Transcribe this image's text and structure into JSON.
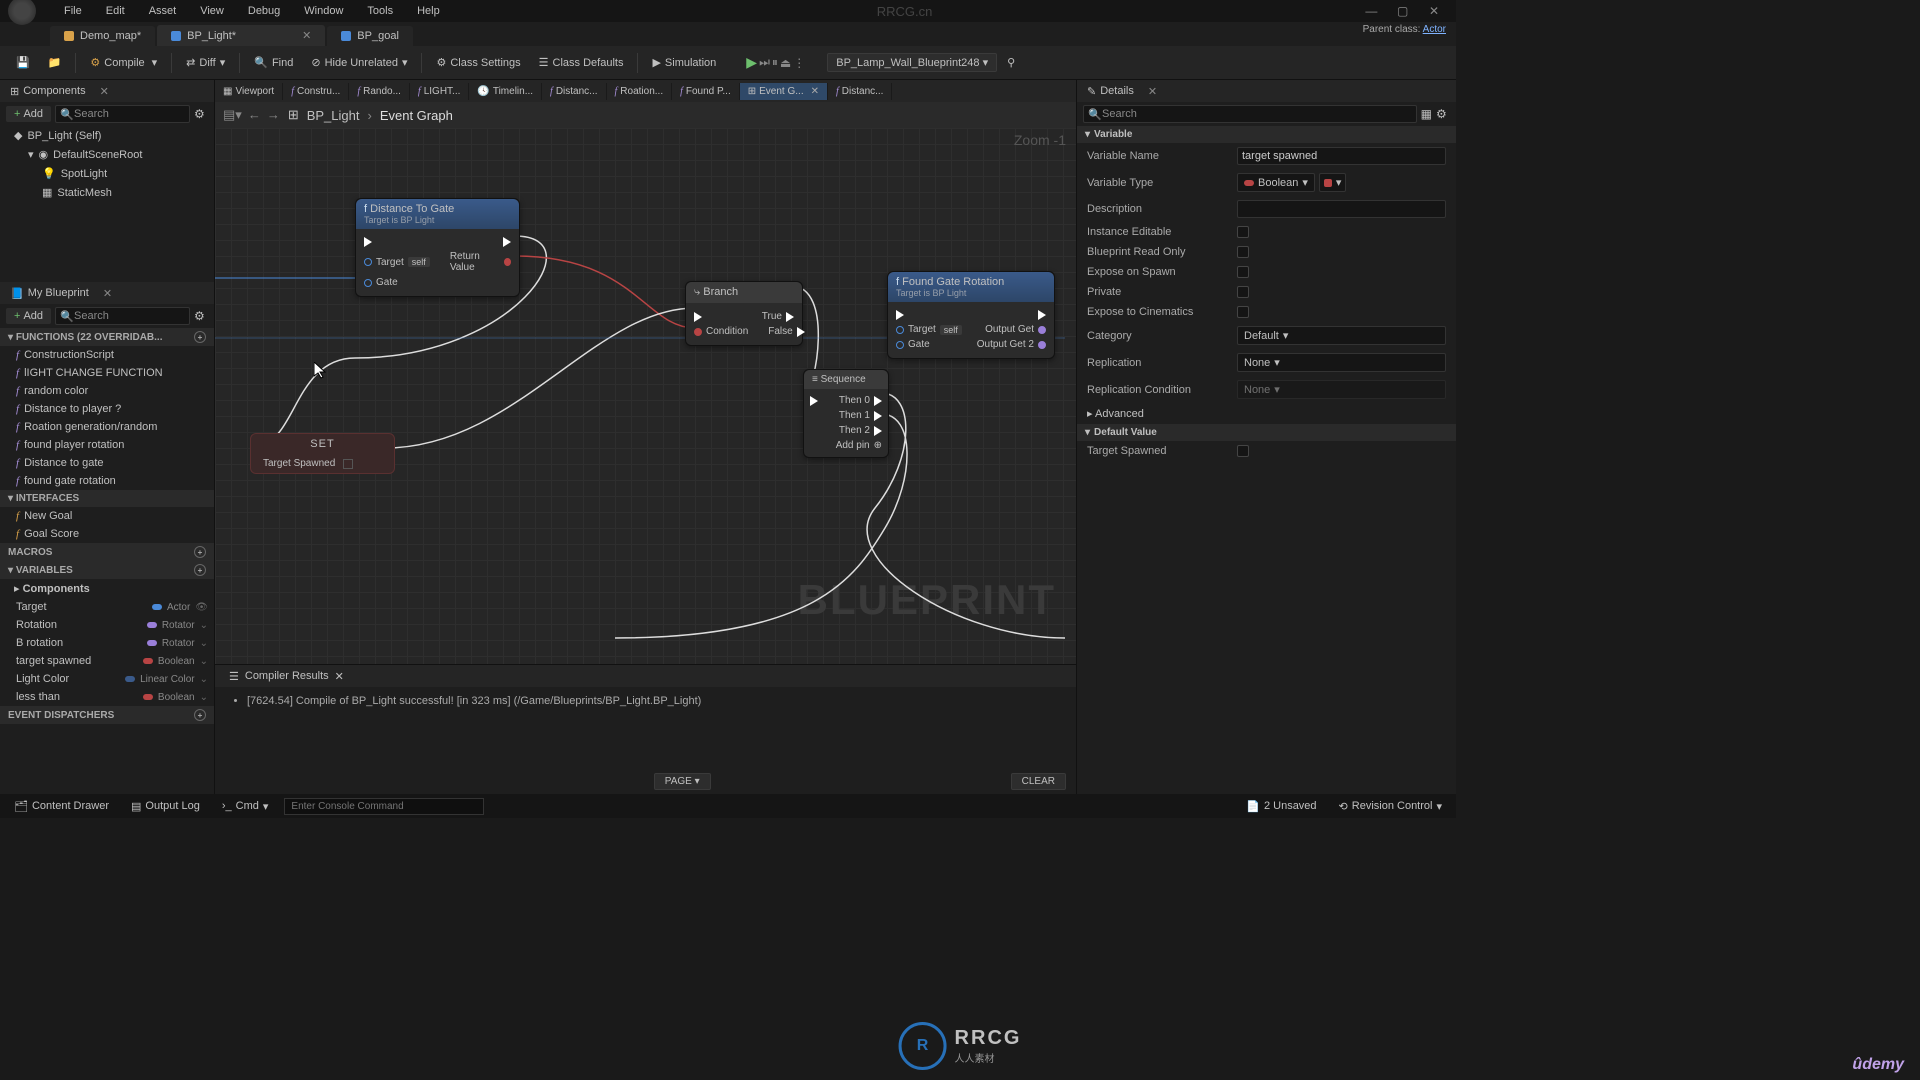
{
  "menu": {
    "items": [
      "File",
      "Edit",
      "Asset",
      "View",
      "Debug",
      "Window",
      "Tools",
      "Help"
    ],
    "center": "RRCG.cn"
  },
  "tabs": [
    {
      "label": "Demo_map*",
      "color": "#d9a24a"
    },
    {
      "label": "BP_Light*",
      "color": "#4a8ad9",
      "active": true
    },
    {
      "label": "BP_goal",
      "color": "#4a8ad9"
    }
  ],
  "parent_class": {
    "prefix": "Parent class:",
    "name": "Actor"
  },
  "toolbar": {
    "compile": "Compile",
    "diff": "Diff",
    "find": "Find",
    "hide": "Hide Unrelated",
    "class_settings": "Class Settings",
    "class_defaults": "Class Defaults",
    "simulation": "Simulation",
    "dropdown": "BP_Lamp_Wall_Blueprint248"
  },
  "components_panel": {
    "title": "Components",
    "add": "Add",
    "search_ph": "Search",
    "items": [
      {
        "label": "BP_Light (Self)",
        "indent": 0
      },
      {
        "label": "DefaultSceneRoot",
        "indent": 1
      },
      {
        "label": "SpotLight",
        "indent": 2
      },
      {
        "label": "StaticMesh",
        "indent": 2
      }
    ]
  },
  "myblueprint": {
    "title": "My Blueprint",
    "add": "Add",
    "search_ph": "Search",
    "functions_head": "FUNCTIONS (22 OVERRIDAB...",
    "functions": [
      "ConstructionScript",
      "lIGHT CHANGE FUNCTION",
      "random color",
      "Distance to player ?",
      "Roation generation/random",
      "found player rotation",
      "Distance to gate",
      "found gate rotation"
    ],
    "interfaces_head": "INTERFACES",
    "interfaces": [
      "New Goal",
      "Goal Score"
    ],
    "macros_head": "MACROS",
    "variables_head": "VARIABLES",
    "components_sub": "Components",
    "variables": [
      {
        "name": "Target",
        "type": "Actor",
        "color": "#4a8ad9"
      },
      {
        "name": "Rotation",
        "type": "Rotator",
        "color": "#9a7fd9"
      },
      {
        "name": "B rotation",
        "type": "Rotator",
        "color": "#9a7fd9"
      },
      {
        "name": "target spawned",
        "type": "Boolean",
        "color": "#b84444"
      },
      {
        "name": "Light Color",
        "type": "Linear Color",
        "color": "#3a5a8a"
      },
      {
        "name": "less than",
        "type": "Boolean",
        "color": "#b84444"
      }
    ],
    "dispatchers_head": "EVENT DISPATCHERS"
  },
  "editor_tabs": [
    {
      "label": "Viewport",
      "icon": "grid"
    },
    {
      "label": "Constru...",
      "icon": "f"
    },
    {
      "label": "Rando...",
      "icon": "f"
    },
    {
      "label": "LIGHT...",
      "icon": "f"
    },
    {
      "label": "Timelin...",
      "icon": "clock"
    },
    {
      "label": "Distanc...",
      "icon": "f"
    },
    {
      "label": "Roation...",
      "icon": "f"
    },
    {
      "label": "Found P...",
      "icon": "f"
    },
    {
      "label": "Event G...",
      "icon": "graph",
      "active": true
    },
    {
      "label": "Distanc...",
      "icon": "f"
    }
  ],
  "breadcrumb": {
    "a": "BP_Light",
    "b": "Event Graph",
    "zoom": "Zoom -1"
  },
  "nodes": {
    "distance": {
      "title": "Distance To Gate",
      "sub": "Target is BP Light",
      "target": "Target",
      "self": "self",
      "gate": "Gate",
      "return": "Return Value"
    },
    "set": {
      "title": "SET",
      "var": "Target Spawned"
    },
    "branch": {
      "title": "Branch",
      "cond": "Condition",
      "true": "True",
      "false": "False"
    },
    "sequence": {
      "title": "Sequence",
      "pins": [
        "Then 0",
        "Then 1",
        "Then 2"
      ],
      "add": "Add pin"
    },
    "found": {
      "title": "Found Gate Rotation",
      "sub": "Target is BP Light",
      "target": "Target",
      "self": "self",
      "gate": "Gate",
      "out1": "Output Get",
      "out2": "Output Get 2"
    }
  },
  "watermark": "BLUEPRINT",
  "compiler": {
    "title": "Compiler Results",
    "msg": "[7624.54] Compile of BP_Light successful! [in 323 ms] (/Game/Blueprints/BP_Light.BP_Light)",
    "page": "PAGE",
    "clear": "CLEAR"
  },
  "details": {
    "title": "Details",
    "search_ph": "Search",
    "sec_variable": "Variable",
    "rows": {
      "name_lbl": "Variable Name",
      "name_val": "target spawned",
      "type_lbl": "Variable Type",
      "type_val": "Boolean",
      "desc_lbl": "Description",
      "inst_lbl": "Instance Editable",
      "ro_lbl": "Blueprint Read Only",
      "spawn_lbl": "Expose on Spawn",
      "priv_lbl": "Private",
      "cine_lbl": "Expose to Cinematics",
      "cat_lbl": "Category",
      "cat_val": "Default",
      "rep_lbl": "Replication",
      "rep_val": "None",
      "repc_lbl": "Replication Condition",
      "repc_val": "None",
      "adv_lbl": "Advanced",
      "def_head": "Default Value",
      "def_lbl": "Target Spawned"
    }
  },
  "statusbar": {
    "drawer": "Content Drawer",
    "log": "Output Log",
    "cmd": "Cmd",
    "cmd_ph": "Enter Console Command",
    "unsaved": "2 Unsaved",
    "revision": "Revision Control"
  },
  "overlay": {
    "brand": "RRCG",
    "sub": "人人素材",
    "udemy": "ûdemy"
  }
}
